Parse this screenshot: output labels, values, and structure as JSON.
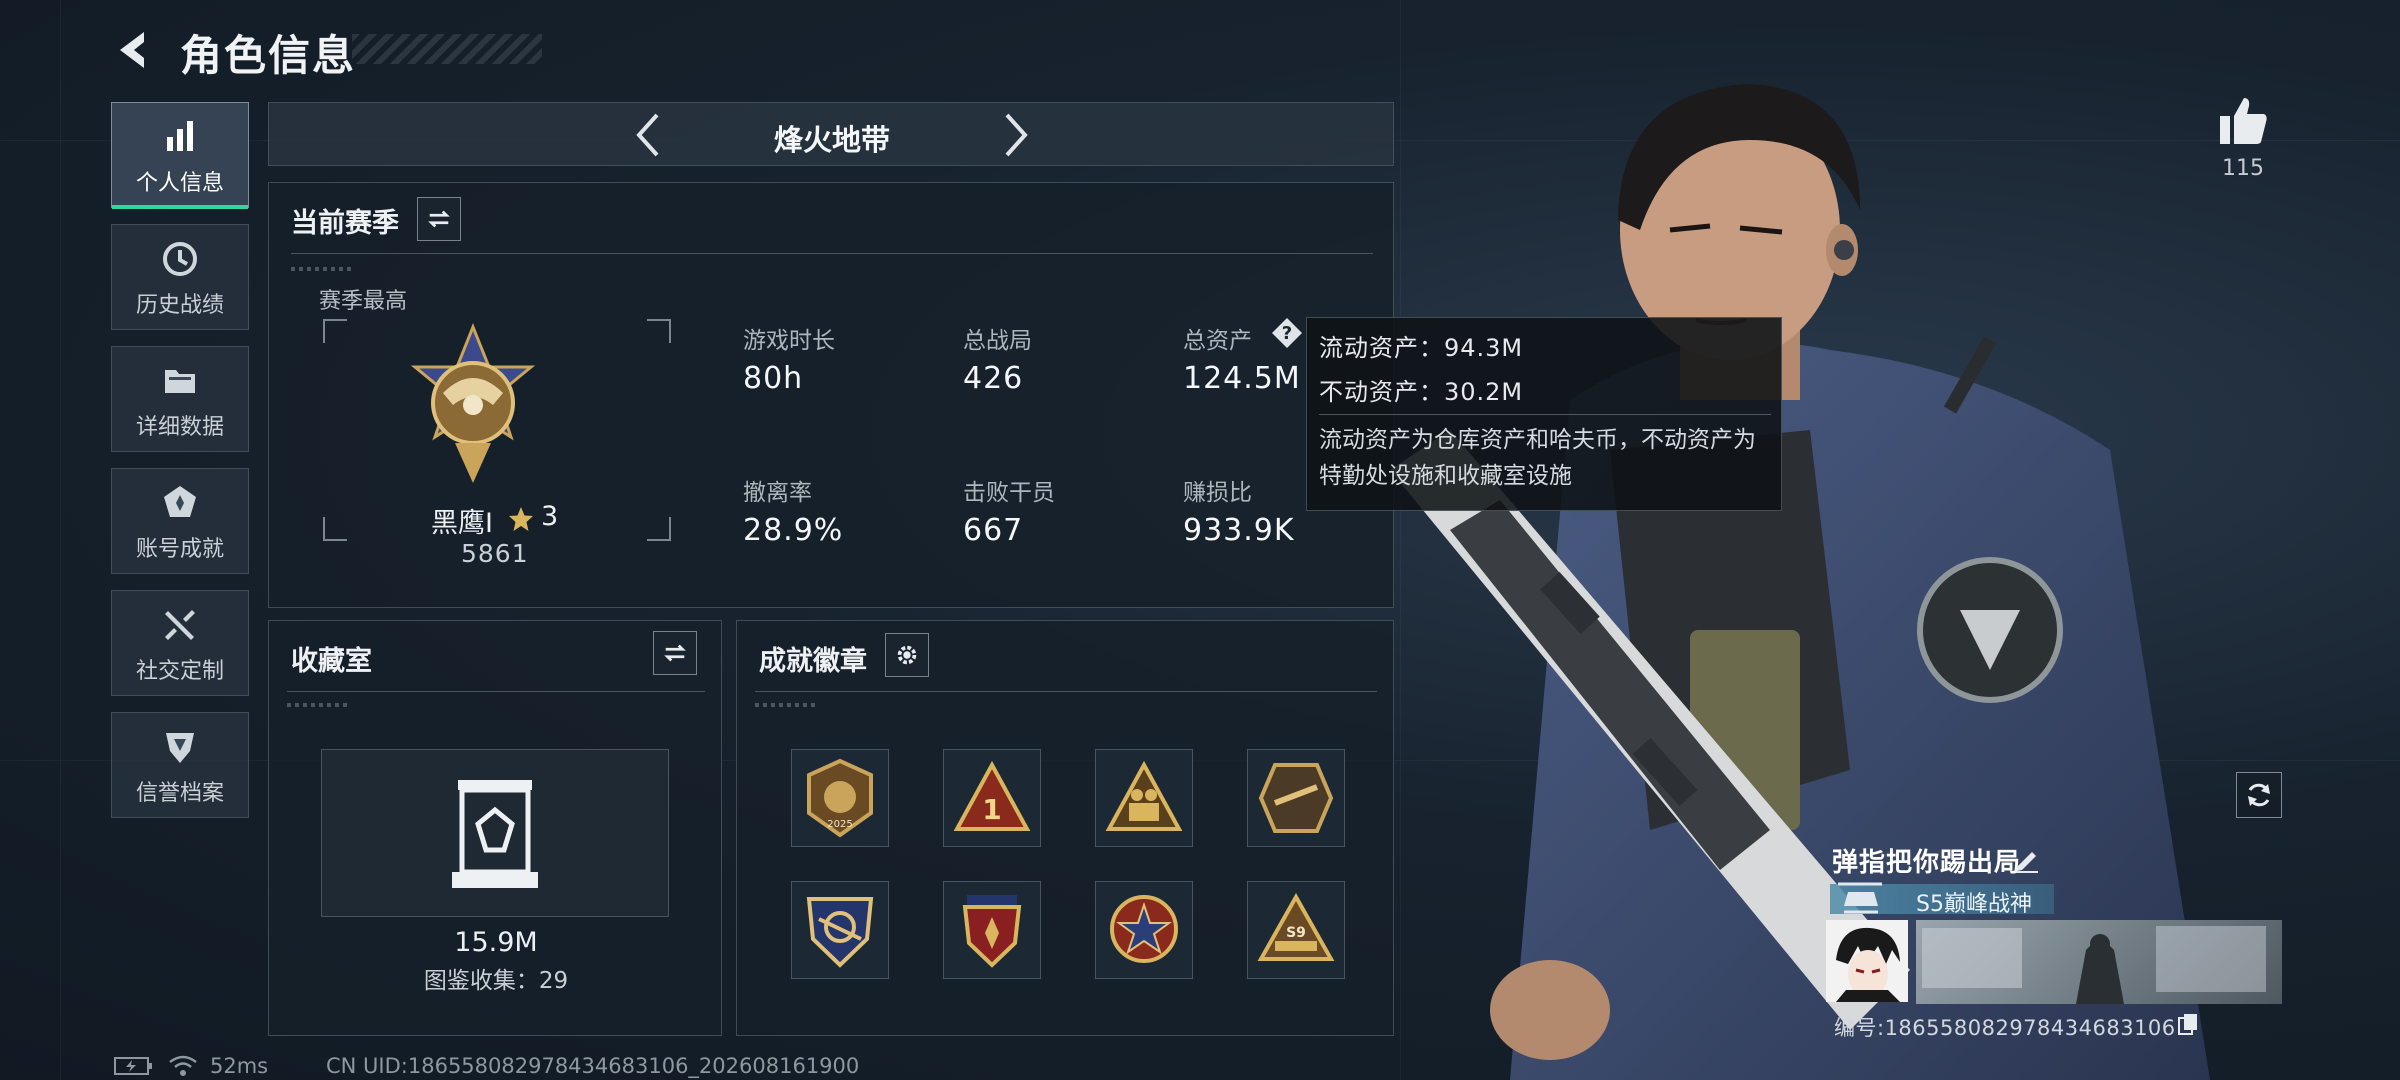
{
  "header": {
    "title": "角色信息"
  },
  "nav": {
    "items": [
      {
        "label": "个人信息",
        "icon": "bar-chart-icon",
        "active": true
      },
      {
        "label": "历史战绩",
        "icon": "history-clock-icon",
        "active": false
      },
      {
        "label": "详细数据",
        "icon": "folder-icon",
        "active": false
      },
      {
        "label": "账号成就",
        "icon": "achievement-icon",
        "active": false
      },
      {
        "label": "社交定制",
        "icon": "tools-icon",
        "active": false
      },
      {
        "label": "信誉档案",
        "icon": "shield-badge-icon",
        "active": false
      }
    ]
  },
  "mode": {
    "title": "烽火地带"
  },
  "season": {
    "title": "当前赛季",
    "best_label": "赛季最高",
    "rank_name": "黑鹰I",
    "rank_stars": "3",
    "rank_score": "5861",
    "stats": [
      {
        "label": "游戏时长",
        "value": "80h"
      },
      {
        "label": "总战局",
        "value": "426"
      },
      {
        "label": "总资产",
        "value": "124.5M"
      },
      {
        "label": "撤离率",
        "value": "28.9%"
      },
      {
        "label": "击败干员",
        "value": "667"
      },
      {
        "label": "赚损比",
        "value": "933.9K"
      }
    ]
  },
  "tooltip": {
    "liquid": "流动资产：94.3M",
    "fixed": "不动资产：30.2M",
    "desc": "流动资产为仓库资产和哈夫币，不动资产为特勤处设施和收藏室设施"
  },
  "collection": {
    "title": "收藏室",
    "value": "15.9M",
    "count_text": "图鉴收集：29"
  },
  "badges": {
    "title": "成就徽章",
    "items": [
      "badge-2025-icon",
      "badge-rank-1-icon",
      "badge-soldiers-icon",
      "badge-delta-icon",
      "badge-shield-icon",
      "badge-crest-icon",
      "badge-star-icon",
      "badge-s9-icon"
    ]
  },
  "profile": {
    "likes": "115",
    "name": "弹指把你踢出局",
    "rank_title": "S5巅峰战神",
    "id_text": "编号:186558082978434683106"
  },
  "status": {
    "ping": "52ms",
    "uid": "CN UID:186558082978434683106_202608161900"
  },
  "colors": {
    "accent_green": "#2fd6a0",
    "gold": "#c9a45a",
    "panel_bg": "#16202a"
  }
}
